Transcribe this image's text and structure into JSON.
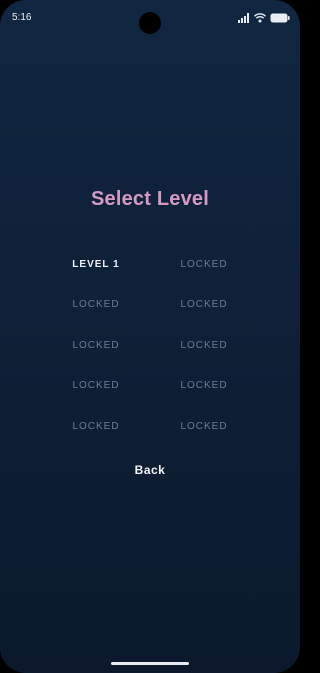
{
  "status_bar": {
    "time": "5:16",
    "icons": [
      "signal-icon",
      "wifi-icon",
      "battery-icon"
    ]
  },
  "screen": {
    "title": "Select Level",
    "levels": [
      {
        "label": "LEVEL 1",
        "locked": false
      },
      {
        "label": "LOCKED",
        "locked": true
      },
      {
        "label": "LOCKED",
        "locked": true
      },
      {
        "label": "LOCKED",
        "locked": true
      },
      {
        "label": "LOCKED",
        "locked": true
      },
      {
        "label": "LOCKED",
        "locked": true
      },
      {
        "label": "LOCKED",
        "locked": true
      },
      {
        "label": "LOCKED",
        "locked": true
      },
      {
        "label": "LOCKED",
        "locked": true
      },
      {
        "label": "LOCKED",
        "locked": true
      }
    ],
    "back_label": "Back"
  },
  "colors": {
    "title": "#d59ac2",
    "unlocked": "#eef2f8",
    "locked": "#6d7d93",
    "background_top": "#112640",
    "background_bottom": "#0c192c"
  }
}
